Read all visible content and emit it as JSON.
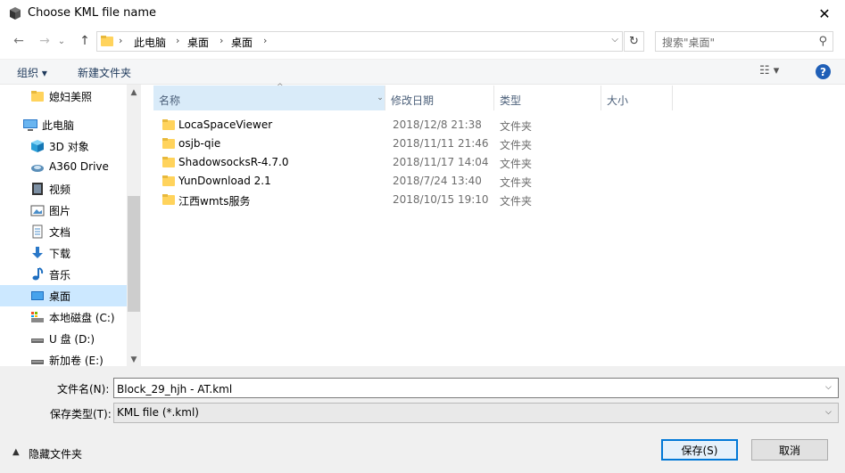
{
  "window": {
    "title": "Choose KML file name",
    "close_glyph": "✕"
  },
  "nav": {
    "back_glyph": "←",
    "forward_glyph": "→",
    "dropdown_glyph": "⌄",
    "up_glyph": "↑",
    "breadcrumbs": [
      "此电脑",
      "桌面",
      "桌面"
    ],
    "crumb_sep": "›",
    "address_dropdown": "⌵",
    "refresh_glyph": "↻",
    "search_placeholder": "搜索\"桌面\"",
    "search_glyph": "⚲"
  },
  "toolbar": {
    "organize_label": "组织 ▾",
    "new_folder_label": "新建文件夹",
    "view_glyph": "☷ ▾",
    "help_label": "?"
  },
  "sidebar": {
    "items": [
      {
        "label": "媳妇美照",
        "icon": "folder-icon"
      },
      {
        "label": "此电脑",
        "icon": "computer-icon"
      },
      {
        "label": "3D 对象",
        "icon": "3d-objects-icon"
      },
      {
        "label": "A360 Drive",
        "icon": "a360-drive-icon"
      },
      {
        "label": "视频",
        "icon": "videos-icon"
      },
      {
        "label": "图片",
        "icon": "pictures-icon"
      },
      {
        "label": "文档",
        "icon": "documents-icon"
      },
      {
        "label": "下载",
        "icon": "downloads-icon"
      },
      {
        "label": "音乐",
        "icon": "music-icon"
      },
      {
        "label": "桌面",
        "icon": "desktop-icon"
      },
      {
        "label": "本地磁盘 (C:)",
        "icon": "local-disk-icon"
      },
      {
        "label": "U 盘 (D:)",
        "icon": "usb-drive-icon"
      },
      {
        "label": "新加卷 (E:)",
        "icon": "volume-icon"
      }
    ],
    "selected_index": 9,
    "scroll_up": "▲",
    "scroll_down": "▼"
  },
  "columns": {
    "name": "名称",
    "date": "修改日期",
    "type": "类型",
    "size": "大小",
    "sort_arrow": "^",
    "resize_glyph": "⌄"
  },
  "files": [
    {
      "name": "LocaSpaceViewer",
      "date": "2018/12/8 21:38",
      "type": "文件夹"
    },
    {
      "name": "osjb-qie",
      "date": "2018/11/11 21:46",
      "type": "文件夹"
    },
    {
      "name": "ShadowsocksR-4.7.0",
      "date": "2018/11/17 14:04",
      "type": "文件夹"
    },
    {
      "name": "YunDownload 2.1",
      "date": "2018/7/24 13:40",
      "type": "文件夹"
    },
    {
      "name": "江西wmts服务",
      "date": "2018/10/15 19:10",
      "type": "文件夹"
    }
  ],
  "form": {
    "filename_label": "文件名(N):",
    "filename_value": "Block_29_hjh - AT.kml",
    "filetype_label": "保存类型(T):",
    "filetype_value": "KML file (*.kml)",
    "dropdown_glyph": "⌵",
    "hide_folders_arrow": "▲",
    "hide_folders_label": "隐藏文件夹",
    "save_label": "保存(S)",
    "cancel_label": "取消"
  },
  "colors": {
    "selection": "#cce8ff",
    "folder": "#ffd35c",
    "primary_button_border": "#0078d7",
    "help_icon": "#1f5fb7"
  }
}
